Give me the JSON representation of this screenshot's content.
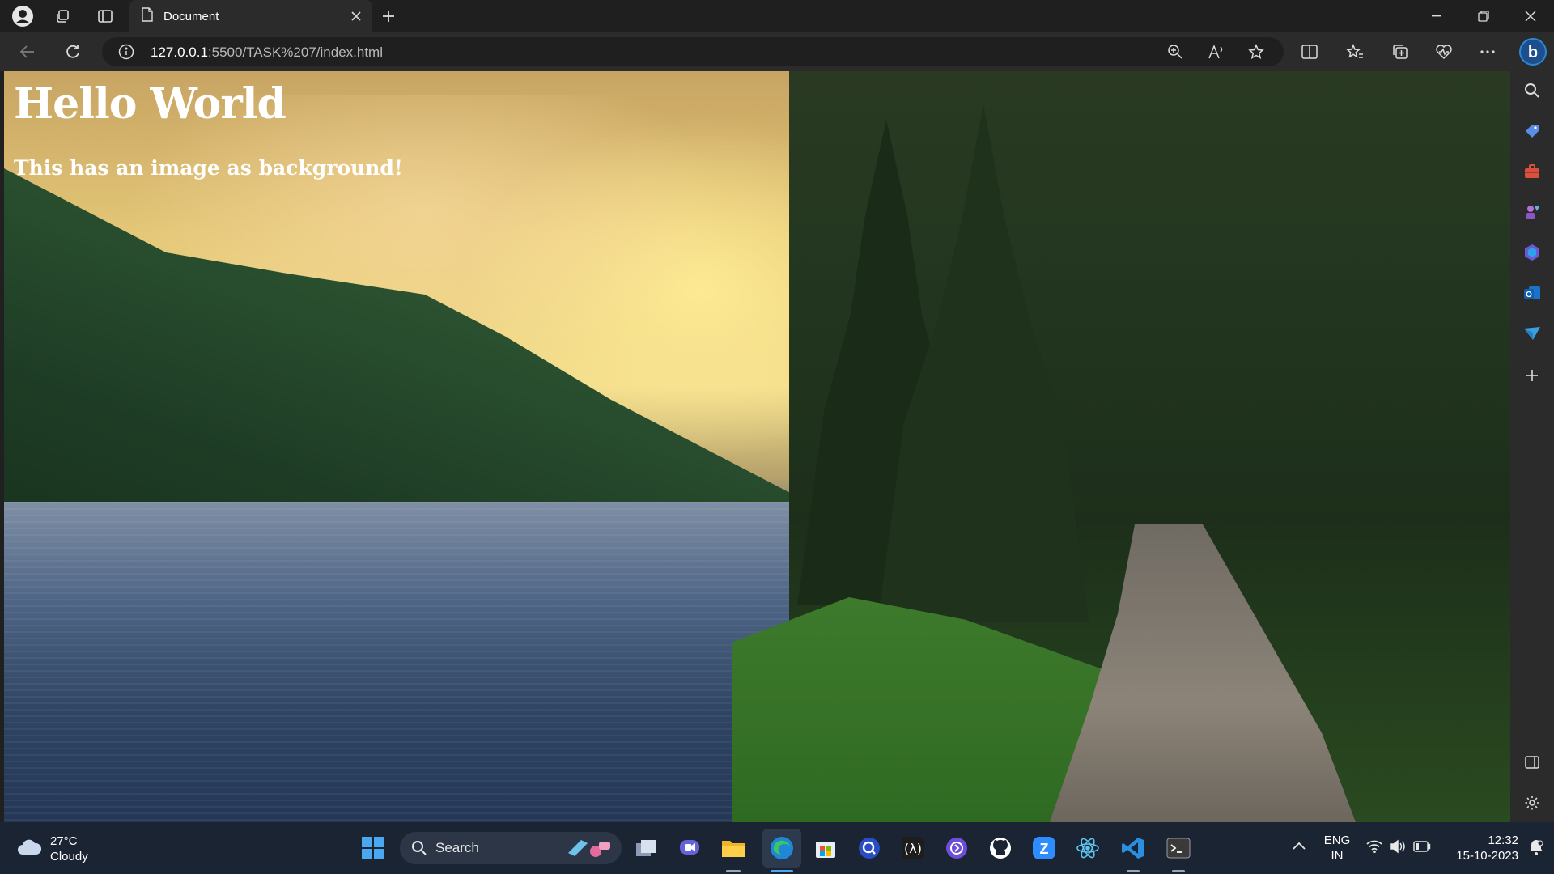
{
  "browser": {
    "tab_title": "Document",
    "url_host": "127.0.0.1",
    "url_path": ":5500/TASK%207/index.html",
    "accent": "#2b88d8"
  },
  "page": {
    "heading": "Hello World",
    "paragraph": "This has an image as background!"
  },
  "taskbar": {
    "weather_temp": "27°C",
    "weather_desc": "Cloudy",
    "search_label": "Search",
    "lang_line1": "ENG",
    "lang_line2": "IN",
    "time": "12:32",
    "date": "15-10-2023"
  }
}
